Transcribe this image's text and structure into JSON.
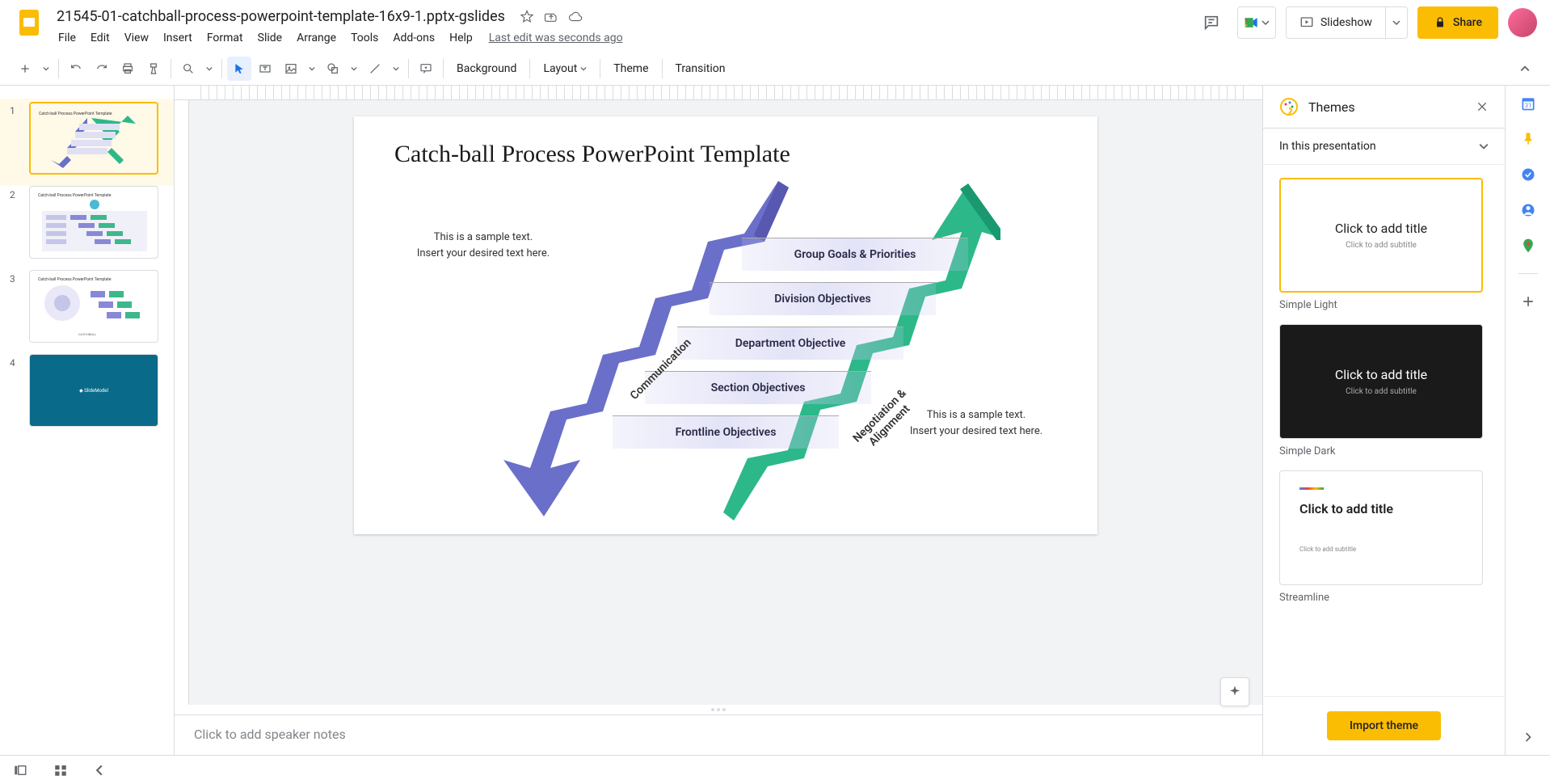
{
  "doc_title": "21545-01-catchball-process-powerpoint-template-16x9-1.pptx-gslides",
  "menus": [
    "File",
    "Edit",
    "View",
    "Insert",
    "Format",
    "Slide",
    "Arrange",
    "Tools",
    "Add-ons",
    "Help"
  ],
  "last_edit": "Last edit was seconds ago",
  "slideshow_label": "Slideshow",
  "share_label": "Share",
  "toolbar_text": {
    "background": "Background",
    "layout": "Layout",
    "theme": "Theme",
    "transition": "Transition"
  },
  "slide_count": 4,
  "active_slide": 1,
  "slide_content": {
    "title": "Catch-ball Process PowerPoint Template",
    "sample_text": "This is a sample text.\nInsert your desired text here.",
    "comm_label": "Communication",
    "neg_label": "Negotiation &\nAlignment",
    "rungs": [
      "Group Goals & Priorities",
      "Division Objectives",
      "Department Objective",
      "Section Objectives",
      "Frontline Objectives"
    ]
  },
  "notes_placeholder": "Click to add speaker notes",
  "themes": {
    "panel_title": "Themes",
    "section": "In this presentation",
    "preview_title": "Click to add title",
    "preview_sub": "Click to add subtitle",
    "items": [
      {
        "name": "Simple Light",
        "variant": "light",
        "selected": true
      },
      {
        "name": "Simple Dark",
        "variant": "dark",
        "selected": false
      },
      {
        "name": "Streamline",
        "variant": "streamline",
        "selected": false
      }
    ],
    "import_label": "Import theme"
  }
}
